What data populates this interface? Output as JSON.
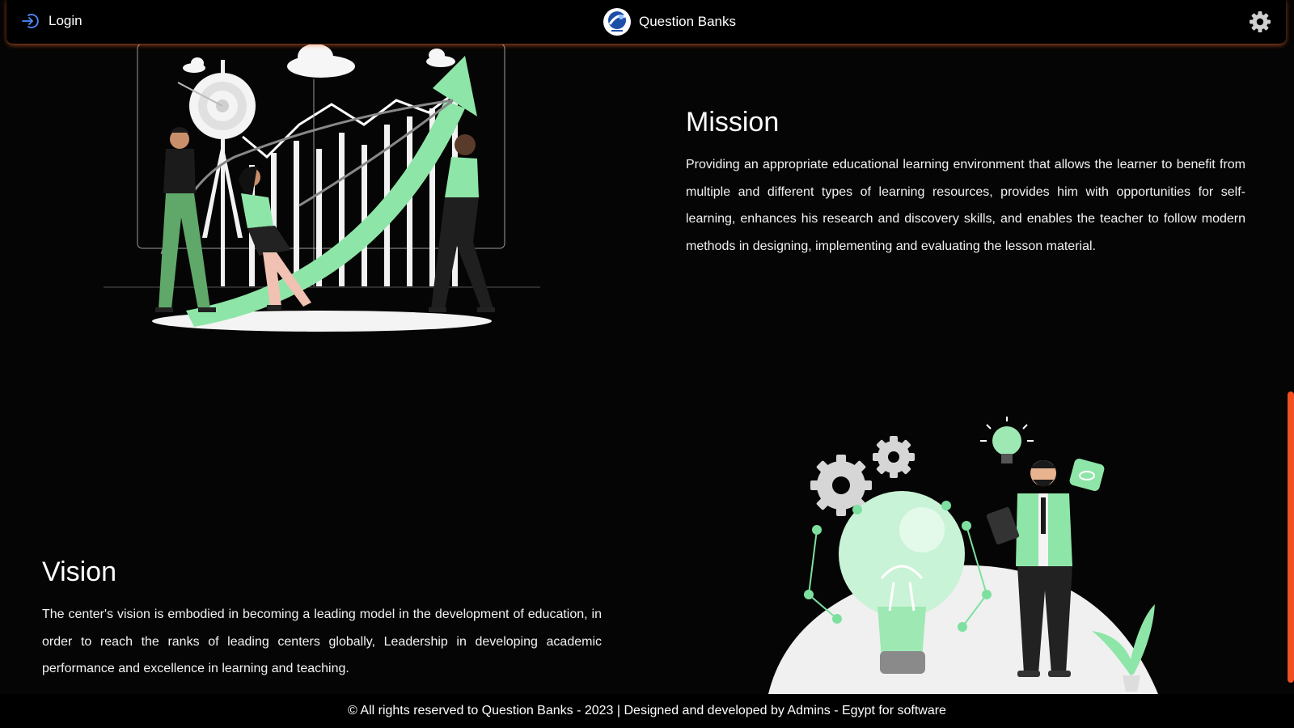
{
  "navbar": {
    "login_label": "Login",
    "brand_name": "Question Banks"
  },
  "mission": {
    "title": "Mission",
    "text": "Providing an appropriate educational learning environment that allows the learner to benefit from multiple and different types of learning resources, provides him with opportunities for self-learning, enhances his research and discovery skills, and enables the teacher to follow modern methods in designing, implementing and evaluating the lesson material."
  },
  "vision": {
    "title": "Vision",
    "text": "The center's vision is embodied in becoming a leading model in the development of education, in order to reach the ranks of leading centers globally, Leadership in developing academic performance and excellence in learning and teaching."
  },
  "footer": {
    "text": "© All rights reserved to Question Banks - 2023 | Designed and developed by Admins - Egypt for software"
  },
  "colors": {
    "background": "#050505",
    "accent_green": "#7ee0a0",
    "scrollbar": "#f05022",
    "nav_glow": "#ff6e28"
  }
}
